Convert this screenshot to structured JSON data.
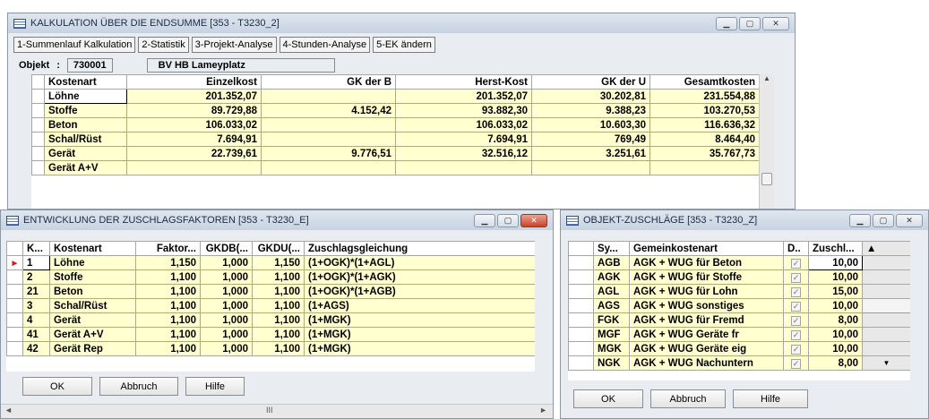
{
  "main_window": {
    "title": "KALKULATION ÜBER DIE ENDSUMME  [353 - T3230_2]",
    "tabs": [
      "1-Summenlauf Kalkulation",
      "2-Statistik",
      "3-Projekt-Analyse",
      "4-Stunden-Analyse",
      "5-EK ändern"
    ],
    "objekt_label": "Objekt",
    "objekt_sep": ":",
    "objekt_value": "730001",
    "objekt_name": "BV HB Lameyplatz",
    "columns": [
      "Kostenart",
      "Einzelkost",
      "GK der B",
      "Herst-Kost",
      "GK der U",
      "Gesamtkosten"
    ],
    "rows": [
      [
        "Löhne",
        "201.352,07",
        "",
        "201.352,07",
        "30.202,81",
        "231.554,88"
      ],
      [
        "Stoffe",
        "89.729,88",
        "4.152,42",
        "93.882,30",
        "9.388,23",
        "103.270,53"
      ],
      [
        "Beton",
        "106.033,02",
        "",
        "106.033,02",
        "10.603,30",
        "116.636,32"
      ],
      [
        "Schal/Rüst",
        "7.694,91",
        "",
        "7.694,91",
        "769,49",
        "8.464,40"
      ],
      [
        "Gerät",
        "22.739,61",
        "9.776,51",
        "32.516,12",
        "3.251,61",
        "35.767,73"
      ],
      [
        "Gerät A+V",
        "",
        "",
        "",
        "",
        ""
      ]
    ]
  },
  "faktoren_window": {
    "title": "ENTWICKLUNG DER ZUSCHLAGSFAKTOREN  [353 - T3230_E]",
    "columns": [
      "K...",
      "Kostenart",
      "Faktor...",
      "GKDB(...",
      "GKDU(...",
      "Zuschlagsgleichung"
    ],
    "rows": [
      [
        "1",
        "Löhne",
        "1,150",
        "1,000",
        "1,150",
        "(1+OGK)*(1+AGL)"
      ],
      [
        "2",
        "Stoffe",
        "1,100",
        "1,000",
        "1,100",
        "(1+OGK)*(1+AGK)"
      ],
      [
        "21",
        "Beton",
        "1,100",
        "1,000",
        "1,100",
        "(1+OGK)*(1+AGB)"
      ],
      [
        "3",
        "Schal/Rüst",
        "1,100",
        "1,000",
        "1,100",
        "(1+AGS)"
      ],
      [
        "4",
        "Gerät",
        "1,100",
        "1,000",
        "1,100",
        "(1+MGK)"
      ],
      [
        "41",
        "Gerät A+V",
        "1,100",
        "1,000",
        "1,100",
        "(1+MGK)"
      ],
      [
        "42",
        "Gerät Rep",
        "1,100",
        "1,000",
        "1,100",
        "(1+MGK)"
      ]
    ],
    "buttons": {
      "ok": "OK",
      "abbruch": "Abbruch",
      "hilfe": "Hilfe"
    },
    "hscroll_grip": "III"
  },
  "zuschlaege_window": {
    "title": "OBJEKT-ZUSCHLÄGE  [353 - T3230_Z]",
    "columns": [
      "Sy...",
      "Gemeinkostenart",
      "D..",
      "Zuschl..."
    ],
    "rows": [
      [
        "AGB",
        "AGK + WUG für Beton",
        "✓",
        "10,00"
      ],
      [
        "AGK",
        "AGK + WUG für Stoffe",
        "✓",
        "10,00"
      ],
      [
        "AGL",
        "AGK + WUG für Lohn",
        "✓",
        "15,00"
      ],
      [
        "AGS",
        "AGK + WUG sonstiges",
        "✓",
        "10,00"
      ],
      [
        "FGK",
        "AGK + WUG für Fremd",
        "✓",
        "8,00"
      ],
      [
        "MGF",
        "AGK + WUG Geräte fr",
        "✓",
        "10,00"
      ],
      [
        "MGK",
        "AGK + WUG Geräte eig",
        "✓",
        "10,00"
      ],
      [
        "NGK",
        "AGK + WUG Nachuntern",
        "✓",
        "8,00"
      ]
    ],
    "buttons": {
      "ok": "OK",
      "abbruch": "Abbruch",
      "hilfe": "Hilfe"
    }
  }
}
